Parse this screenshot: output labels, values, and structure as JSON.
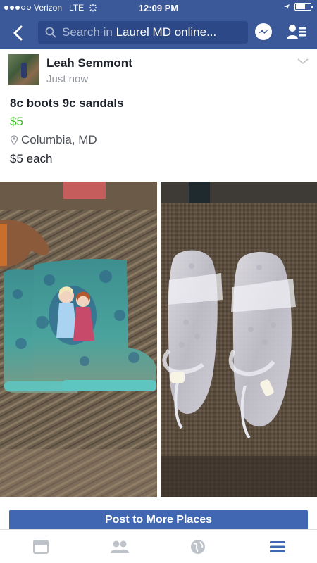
{
  "status_bar": {
    "carrier": "Verizon",
    "network": "LTE",
    "time": "12:09 PM",
    "battery_level": 0.65
  },
  "nav": {
    "search_placeholder": "Search in",
    "search_query": "Laurel MD online..."
  },
  "post": {
    "author": "Leah Semmont",
    "time_ago": "Just now",
    "title": "8c boots 9c sandals",
    "price": "$5",
    "location": "Columbia, MD",
    "description": "$5 each",
    "photos": [
      "boots-photo",
      "sandals-photo"
    ]
  },
  "actions": {
    "post_button": "Post to More Places"
  },
  "bottom_nav": {
    "tabs": [
      "news-feed-icon",
      "groups-icon",
      "notifications-globe-icon",
      "menu-icon"
    ],
    "active_tab": "menu-icon"
  },
  "colors": {
    "header": "#3b5998",
    "price": "#42b72a",
    "button": "#4267b2",
    "active_tab": "#4267b2",
    "inactive_tab": "#bec3c9"
  }
}
